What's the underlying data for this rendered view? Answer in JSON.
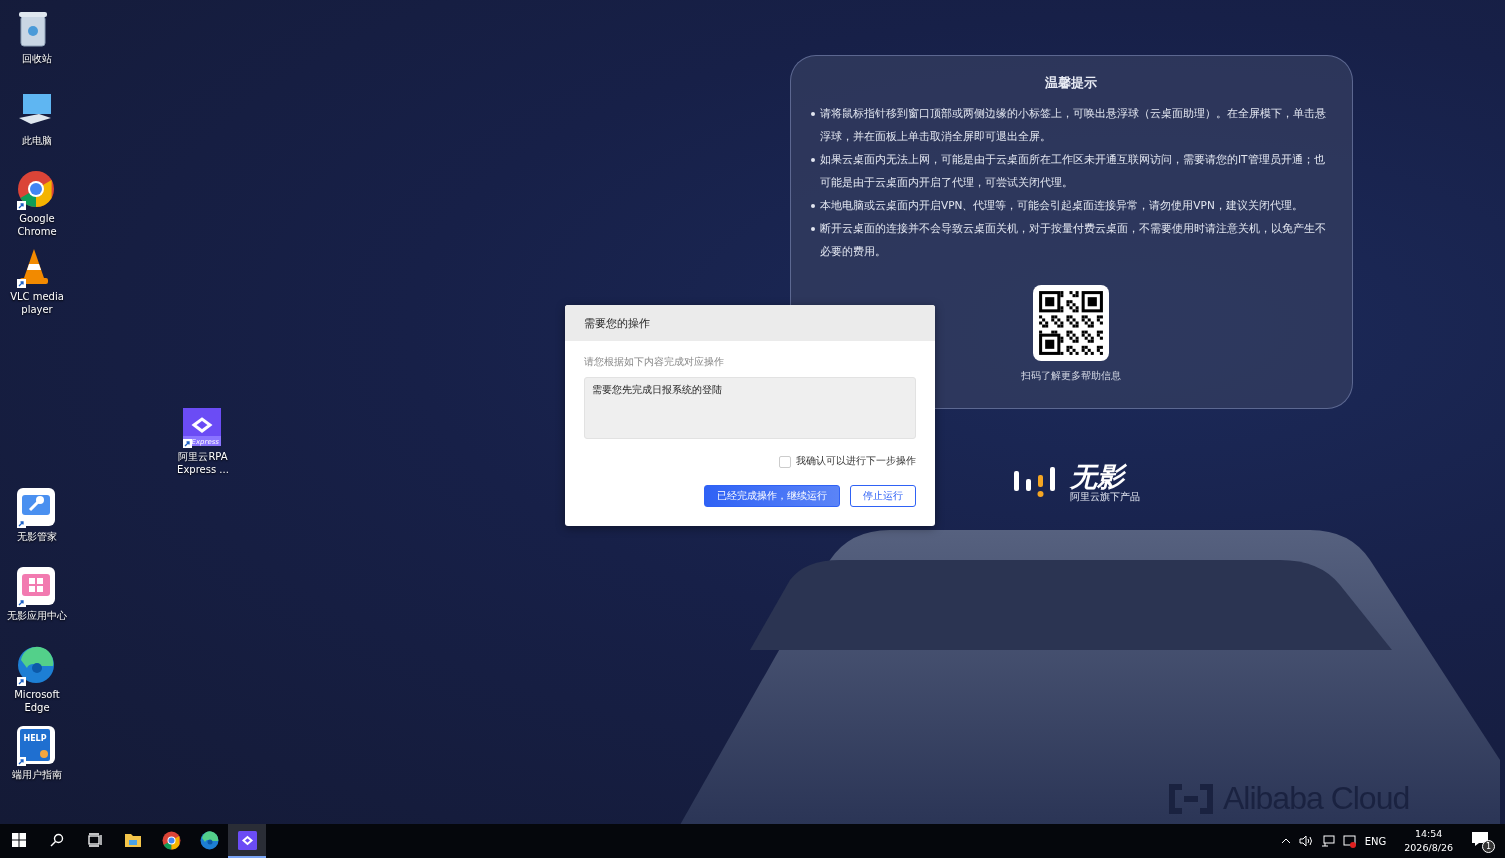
{
  "desktop_icons": [
    {
      "kind": "recycle-bin",
      "label": "回收站",
      "shortcut": false
    },
    {
      "kind": "computer",
      "label": "此电脑",
      "shortcut": false
    },
    {
      "kind": "chrome",
      "label": "Google Chrome",
      "shortcut": true
    },
    {
      "kind": "vlc",
      "label": "VLC media player",
      "shortcut": true
    },
    {
      "kind": "rpa",
      "label": "阿里云RPA Express ...",
      "shortcut": true,
      "badge": "Express"
    },
    {
      "kind": "wrench",
      "label": "无影管家",
      "shortcut": true
    },
    {
      "kind": "apps",
      "label": "无影应用中心",
      "shortcut": true
    },
    {
      "kind": "edge",
      "label": "Microsoft Edge",
      "shortcut": true
    },
    {
      "kind": "guide",
      "label": "端用户指南",
      "shortcut": true,
      "badge": "HELP"
    }
  ],
  "tips_panel": {
    "title": "温馨提示",
    "items": [
      "请将鼠标指针移到窗口顶部或两侧边缘的小标签上，可唤出悬浮球（云桌面助理）。在全屏模下，单击悬浮球，并在面板上单击取消全屏即可退出全屏。",
      "如果云桌面内无法上网，可能是由于云桌面所在工作区未开通互联网访问，需要请您的IT管理员开通；也可能是由于云桌面内开启了代理，可尝试关闭代理。",
      "本地电脑或云桌面内开启VPN、代理等，可能会引起桌面连接异常，请勿使用VPN，建议关闭代理。",
      "断开云桌面的连接并不会导致云桌面关机，对于按量付费云桌面，不需要使用时请注意关机，以免产生不必要的费用。"
    ],
    "qr_caption": "扫码了解更多帮助信息"
  },
  "brand": {
    "name": "无影",
    "tagline": "阿里云旗下产品",
    "vendor": "Alibaba Cloud"
  },
  "dialog": {
    "title": "需要您的操作",
    "instruction": "请您根据如下内容完成对应操作",
    "message": "需要您先完成日报系统的登陆",
    "confirm": {
      "label": "我确认可以进行下一步操作",
      "checked": false
    },
    "buttons": [
      {
        "label": "已经完成操作，继续运行",
        "primary": true
      },
      {
        "label": "停止运行",
        "primary": false
      }
    ]
  },
  "taskbar": {
    "items": [
      {
        "kind": "start",
        "selected": false
      },
      {
        "kind": "search",
        "selected": false
      },
      {
        "kind": "task-view",
        "selected": false
      },
      {
        "kind": "folder",
        "selected": false
      },
      {
        "kind": "chrome",
        "selected": false
      },
      {
        "kind": "edge",
        "selected": false
      },
      {
        "kind": "rpa",
        "selected": true
      }
    ],
    "language": "ENG",
    "time": "14:54",
    "date": "2026/8/26",
    "notifications": "1"
  }
}
